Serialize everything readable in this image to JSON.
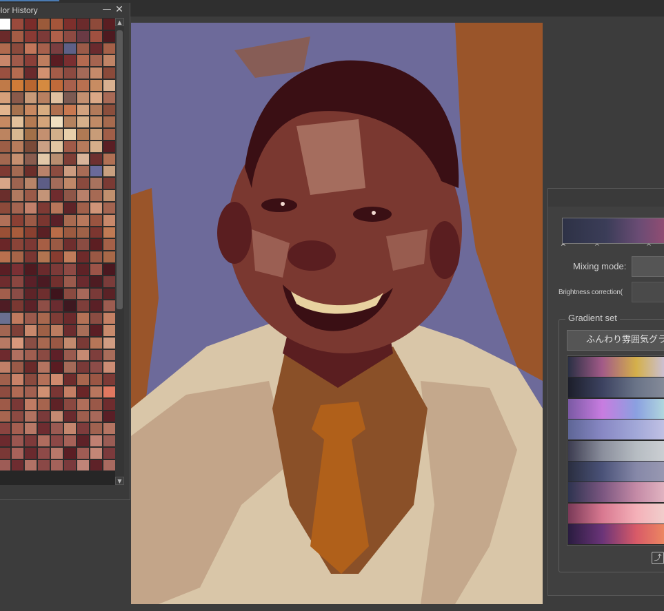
{
  "color_history": {
    "title": "olor History",
    "minimize_glyph": "—",
    "close_glyph": "✕",
    "scroll_up_glyph": "▲",
    "scroll_down_glyph": "▼",
    "swatches": [
      "#ffffff",
      "#9a4a3c",
      "#7a2c2a",
      "#9b5a3a",
      "#a5553a",
      "#7d2f2c",
      "#6b2b2c",
      "#8e4a3a",
      "#5a1e22",
      "#6a2a2a",
      "#a45c45",
      "#8a3a34",
      "#7c3a38",
      "#b0604a",
      "#8d4a42",
      "#6a3a44",
      "#a05040",
      "#4d1a20",
      "#b06a4e",
      "#8a4a3c",
      "#c2765a",
      "#a6604c",
      "#7a3e40",
      "#5e6087",
      "#9a5a48",
      "#6a2a2e",
      "#a46048",
      "#c9866a",
      "#a05a4a",
      "#8a3f38",
      "#be7d5e",
      "#5a1c22",
      "#7a2e30",
      "#b46a50",
      "#a56450",
      "#c08466",
      "#9a5040",
      "#b56c50",
      "#6a2a2c",
      "#d29070",
      "#a45c48",
      "#8c4a40",
      "#a46a58",
      "#c68a6a",
      "#8a4a3a",
      "#c07a48",
      "#d07c38",
      "#b86630",
      "#d58a40",
      "#c06a3a",
      "#a8604c",
      "#b87050",
      "#c88c62",
      "#d8b090",
      "#d6a07a",
      "#8a5a4a",
      "#c89a78",
      "#b88060",
      "#e0c0a0",
      "#7c5a52",
      "#c49070",
      "#dba886",
      "#a86a56",
      "#e2b58e",
      "#a6724e",
      "#c88860",
      "#d8ac80",
      "#b07050",
      "#c87850",
      "#d2a27e",
      "#b27a5a",
      "#8a4e3c",
      "#c68a62",
      "#e2c09a",
      "#b47a52",
      "#d4a47a",
      "#f0dfc0",
      "#b4825e",
      "#d6b08a",
      "#c08a66",
      "#a66a4e",
      "#bc8460",
      "#d8b890",
      "#a27048",
      "#c49070",
      "#d2b08a",
      "#e8d0aa",
      "#b07a54",
      "#c89c78",
      "#a05e48",
      "#9c5e46",
      "#b87c5c",
      "#7a4a38",
      "#caa084",
      "#e2c6a2",
      "#a05a48",
      "#b67a5c",
      "#d6ae8a",
      "#5a1e24",
      "#a26850",
      "#c69070",
      "#8a5c4e",
      "#e2c8a8",
      "#b88e70",
      "#7e3e36",
      "#d8b49a",
      "#6e3030",
      "#b07054",
      "#7e3a32",
      "#a46a52",
      "#6c2e2a",
      "#b9826a",
      "#8c4c40",
      "#cc9c80",
      "#a86c56",
      "#6a6a9a",
      "#c8a080",
      "#d8a688",
      "#9e6450",
      "#b88468",
      "#5d5d86",
      "#a46c5a",
      "#c08868",
      "#8a4a3e",
      "#a8725e",
      "#7a3a34",
      "#6a2e2c",
      "#b07a60",
      "#9a5a48",
      "#c49478",
      "#6f2c2e",
      "#8e5648",
      "#b8806a",
      "#a66a54",
      "#c0906e",
      "#8c4a3a",
      "#a46450",
      "#c2806a",
      "#7e3a34",
      "#b8765a",
      "#5e2428",
      "#a0604a",
      "#d09478",
      "#a36450",
      "#b07058",
      "#8a4034",
      "#9c5a46",
      "#7a3630",
      "#5a2028",
      "#a86a50",
      "#b8785c",
      "#9a5440",
      "#c8886a",
      "#9a5036",
      "#a85c3c",
      "#8a4030",
      "#5a2024",
      "#b86c48",
      "#9c5a40",
      "#a06248",
      "#7c3630",
      "#c07a54",
      "#6a2628",
      "#8a4438",
      "#7c3834",
      "#a65e44",
      "#9a5a44",
      "#6e2e2e",
      "#8a4c42",
      "#5c1e22",
      "#a46048",
      "#b8704e",
      "#a66448",
      "#7a3632",
      "#b27450",
      "#883c30",
      "#c07c5a",
      "#6e2a2a",
      "#9a5844",
      "#a86848",
      "#5a1e24",
      "#7a3034",
      "#4e1a20",
      "#6a2a2c",
      "#7c3a38",
      "#8e4a44",
      "#5e2226",
      "#9c5448",
      "#4a1820",
      "#6e2c2e",
      "#8a4640",
      "#5a2028",
      "#4a1a22",
      "#72302e",
      "#9a5a4c",
      "#6a2a2e",
      "#4e1c22",
      "#7a3c3a",
      "#a25e4c",
      "#8a4c46",
      "#5e2428",
      "#6e2e2e",
      "#3e141c",
      "#8a4a40",
      "#a8685a",
      "#7a3a38",
      "#5a2226",
      "#4e1c24",
      "#7a3832",
      "#5c2228",
      "#8e4e46",
      "#6a2c30",
      "#3e1820",
      "#7e3e3a",
      "#5a2026",
      "#9c5c50",
      "#6a7090",
      "#c07a5e",
      "#9a5a4c",
      "#a8684e",
      "#7e3c36",
      "#6a2a2c",
      "#b47256",
      "#8a4c42",
      "#c48064",
      "#a26652",
      "#7e4038",
      "#c8886c",
      "#9e6046",
      "#bc7c60",
      "#6c2c2e",
      "#a86e58",
      "#5a1e24",
      "#c88a6c",
      "#b87a64",
      "#d8987c",
      "#8a4e44",
      "#a86850",
      "#9a5844",
      "#c48a6e",
      "#7a3a36",
      "#b67658",
      "#d09c82",
      "#6e2a2e",
      "#b07060",
      "#a05e50",
      "#8a4a42",
      "#5e2028",
      "#9a5a4e",
      "#c68a72",
      "#7e3e3c",
      "#a86c5a",
      "#c08068",
      "#9a5a48",
      "#6a2a2a",
      "#b47460",
      "#5a1c22",
      "#a46a58",
      "#7a3a38",
      "#8c4c48",
      "#cc8c74",
      "#a0604c",
      "#c88268",
      "#8a4a3e",
      "#b47058",
      "#d08a6e",
      "#6e2c2c",
      "#a8664e",
      "#9a5644",
      "#7c3a36",
      "#8e4c40",
      "#b06a54",
      "#a26050",
      "#d09072",
      "#7a3634",
      "#c47e64",
      "#6a2628",
      "#b8765e",
      "#e07860",
      "#9e5a48",
      "#7a3836",
      "#c07c64",
      "#a6644e",
      "#5e2226",
      "#8a4840",
      "#b06e5a",
      "#9a5848",
      "#6e2c2e",
      "#a86650",
      "#8c4a42",
      "#b27260",
      "#7a3a3a",
      "#c48a72",
      "#6a2a2e",
      "#9e5e4e",
      "#a8685a",
      "#5a1e26",
      "#8a4440",
      "#a45e50",
      "#b87866",
      "#6e2c30",
      "#9a5a52",
      "#c4866e",
      "#7e3c3c",
      "#a06250",
      "#b47462",
      "#6c2a2e",
      "#9a5650",
      "#7e3a3a",
      "#b06c5e",
      "#8c4846",
      "#a66258",
      "#5e2228",
      "#c08072",
      "#9a5c54",
      "#7a3836",
      "#a8625a",
      "#6a2a2e",
      "#8e4a48",
      "#b8786a",
      "#5a1e24",
      "#a05c54",
      "#c48676",
      "#7c3a3c",
      "#9e5c56",
      "#6e2c30",
      "#b27266",
      "#8a4846",
      "#a4625a",
      "#7a3a3c",
      "#c08478",
      "#5e2228",
      "#a86a60"
    ]
  },
  "canvas": {
    "colors": {
      "bg_violet": "#6d6a9a",
      "bg_orange": "#9a552a",
      "skin_dark": "#5a1e20",
      "skin_mid": "#7a3830",
      "skin_light": "#b07a6a",
      "hair": "#3a0f14",
      "shirt": "#d9c6a8",
      "shirt_shadow": "#b08a70",
      "undershirt": "#8a5028",
      "tie": "#b0601a",
      "teeth": "#e8d2a0"
    }
  },
  "gradient_panel": {
    "mixing_mode_label": "Mixing mode:",
    "brightness_label": "Brightness correction(",
    "gradient_set_label": "Gradient set",
    "gradient_set_value": "ふんわり雰囲気グラ",
    "stop_glyph": "^",
    "footer_icon_glyph": "⤴",
    "gradients": [
      [
        "#2a3044",
        "#a25a88",
        "#d4b04a",
        "#c9c3f0"
      ],
      [
        "#1c1e2a",
        "#3c4260",
        "#6a7488",
        "#8a8f9c"
      ],
      [
        "#7a5aa4",
        "#c87ce0",
        "#8aa0e0",
        "#b8e2dc"
      ],
      [
        "#5e6696",
        "#8888c4",
        "#a2a8d8",
        "#c6c6e6"
      ],
      [
        "#3c3c50",
        "#8a8e9c",
        "#b6bcc2",
        "#cfd2d6"
      ],
      [
        "#2a2e40",
        "#4a5278",
        "#8688a8",
        "#9c9cb4"
      ],
      [
        "#2e3450",
        "#7a5680",
        "#c48aa6",
        "#e6bcc6"
      ],
      [
        "#7a3a58",
        "#d87890",
        "#f4b0b8",
        "#f0d4d0"
      ],
      [
        "#2a1c40",
        "#6a3478",
        "#d85a68",
        "#f09060"
      ]
    ]
  }
}
